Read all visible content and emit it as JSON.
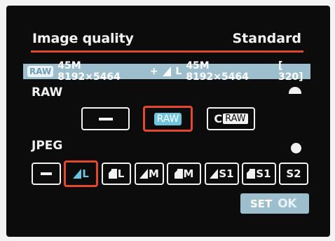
{
  "header": {
    "title": "Image quality",
    "value": "Standard"
  },
  "info_bar": {
    "raw_chip": "RAW",
    "raw_size": "45M 8192×5464",
    "plus": "+",
    "jpeg_size_letter": "L",
    "jpeg_size": "45M 8192×5464",
    "shots_remaining": "[ 320]"
  },
  "raw_section": {
    "label": "RAW",
    "options": [
      "—",
      "RAW",
      "C RAW"
    ],
    "selected_index": 1,
    "craw_c": "C",
    "craw_text": "RAW"
  },
  "jpeg_section": {
    "label": "JPEG",
    "options": [
      "—",
      "L",
      "L",
      "M",
      "M",
      "S1",
      "S1",
      "S2"
    ],
    "selected_index": 1
  },
  "footer": {
    "set_label": "SET",
    "ok_label": "OK"
  },
  "colors": {
    "accent": "#e2472f",
    "info_bar_bg": "#9dbfcd",
    "selected_raw_fill": "#6fc4de"
  }
}
